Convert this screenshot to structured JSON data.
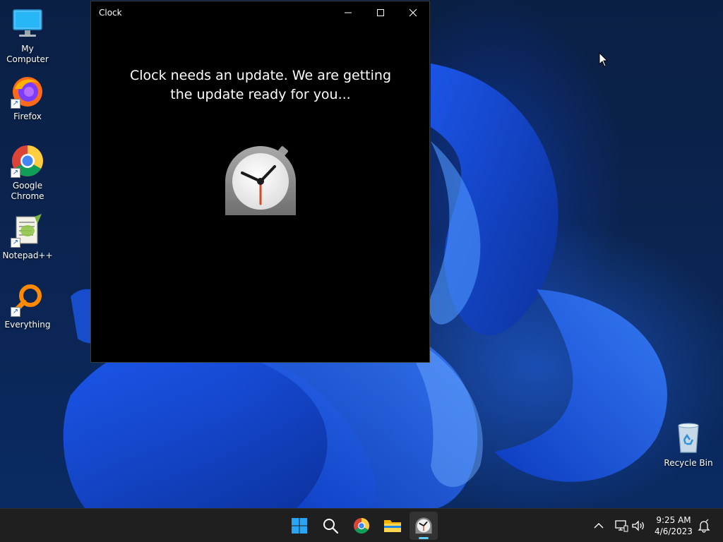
{
  "desktop": {
    "icons": [
      {
        "label": "My Computer"
      },
      {
        "label": "Firefox"
      },
      {
        "label": "Google Chrome"
      },
      {
        "label": "Notepad++"
      },
      {
        "label": "Everything"
      },
      {
        "label": "Recycle Bin"
      }
    ]
  },
  "window": {
    "title": "Clock",
    "message": "Clock needs an update. We are getting the update ready for you..."
  },
  "taskbar": {
    "time": "9:25 AM",
    "date": "4/6/2023",
    "apps": [
      "start-icon",
      "search-icon",
      "chrome-icon",
      "file-explorer-icon",
      "clock-icon"
    ]
  },
  "colors": {
    "accent": "#60cdff",
    "taskbar": "#1f1f1f",
    "window_bg": "#000000"
  }
}
